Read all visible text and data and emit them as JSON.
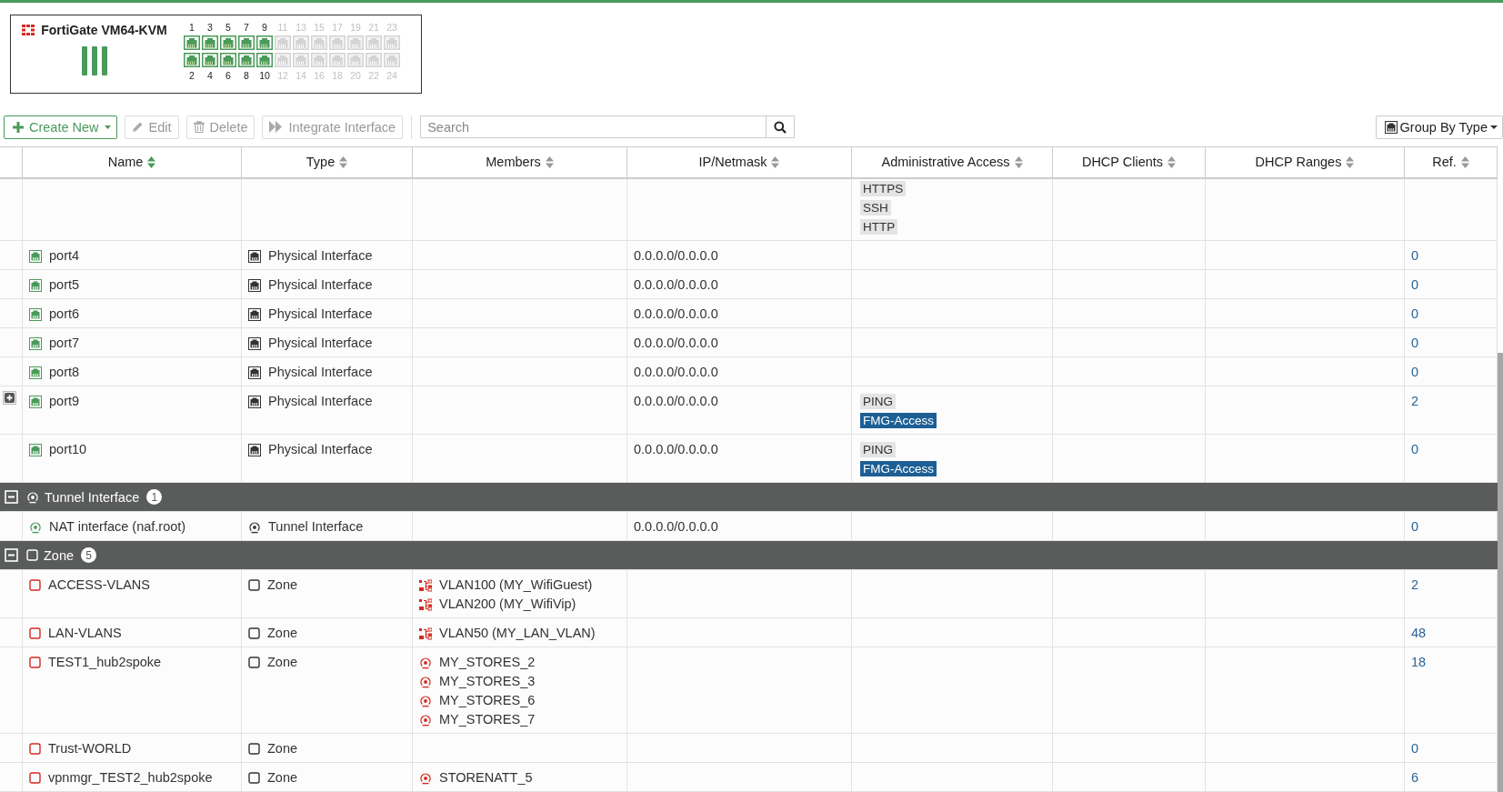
{
  "device": {
    "name": "FortiGate VM64-KVM",
    "ports_top": [
      {
        "label": "1",
        "active": true
      },
      {
        "label": "3",
        "active": true
      },
      {
        "label": "5",
        "active": true
      },
      {
        "label": "7",
        "active": true
      },
      {
        "label": "9",
        "active": true
      },
      {
        "label": "11",
        "active": false
      },
      {
        "label": "13",
        "active": false
      },
      {
        "label": "15",
        "active": false
      },
      {
        "label": "17",
        "active": false
      },
      {
        "label": "19",
        "active": false
      },
      {
        "label": "21",
        "active": false
      },
      {
        "label": "23",
        "active": false
      }
    ],
    "ports_bottom": [
      {
        "label": "2",
        "active": true
      },
      {
        "label": "4",
        "active": true
      },
      {
        "label": "6",
        "active": true
      },
      {
        "label": "8",
        "active": true
      },
      {
        "label": "10",
        "active": true
      },
      {
        "label": "12",
        "active": false
      },
      {
        "label": "14",
        "active": false
      },
      {
        "label": "16",
        "active": false
      },
      {
        "label": "18",
        "active": false
      },
      {
        "label": "20",
        "active": false
      },
      {
        "label": "22",
        "active": false
      },
      {
        "label": "24",
        "active": false
      }
    ]
  },
  "toolbar": {
    "buttons": [
      {
        "kind": "create",
        "label": "Create New",
        "disabled": false
      },
      {
        "kind": "edit",
        "label": "Edit",
        "disabled": true
      },
      {
        "kind": "delete",
        "label": "Delete",
        "disabled": true
      },
      {
        "kind": "integrate",
        "label": "Integrate Interface",
        "disabled": true
      }
    ],
    "search": {
      "placeholder": "Search"
    },
    "group_by": {
      "label": "Group By Type"
    }
  },
  "table": {
    "columns": [
      {
        "label": "Name",
        "sorted": true
      },
      {
        "label": "Type",
        "sorted": false
      },
      {
        "label": "Members",
        "sorted": false
      },
      {
        "label": "IP/Netmask",
        "sorted": false
      },
      {
        "label": "Administrative Access",
        "sorted": false
      },
      {
        "label": "DHCP Clients",
        "sorted": false
      },
      {
        "label": "DHCP Ranges",
        "sorted": false
      },
      {
        "label": "Ref.",
        "sorted": false
      }
    ],
    "rows": [
      {
        "kind": "partial",
        "access": [
          {
            "label": "HTTPS",
            "highlighted": false
          },
          {
            "label": "SSH",
            "highlighted": false
          },
          {
            "label": "HTTP",
            "highlighted": false
          }
        ]
      },
      {
        "kind": "port",
        "name": "port4",
        "type": "Physical Interface",
        "ip": "0.0.0.0/0.0.0.0",
        "ref": "0",
        "expandable": false
      },
      {
        "kind": "port",
        "name": "port5",
        "type": "Physical Interface",
        "ip": "0.0.0.0/0.0.0.0",
        "ref": "0",
        "expandable": false
      },
      {
        "kind": "port",
        "name": "port6",
        "type": "Physical Interface",
        "ip": "0.0.0.0/0.0.0.0",
        "ref": "0",
        "expandable": false
      },
      {
        "kind": "port",
        "name": "port7",
        "type": "Physical Interface",
        "ip": "0.0.0.0/0.0.0.0",
        "ref": "0",
        "expandable": false
      },
      {
        "kind": "port",
        "name": "port8",
        "type": "Physical Interface",
        "ip": "0.0.0.0/0.0.0.0",
        "ref": "0",
        "expandable": false
      },
      {
        "kind": "port",
        "name": "port9",
        "type": "Physical Interface",
        "ip": "0.0.0.0/0.0.0.0",
        "access": [
          {
            "label": "PING",
            "highlighted": false
          },
          {
            "label": "FMG-Access",
            "highlighted": true
          }
        ],
        "ref": "2",
        "expandable": true
      },
      {
        "kind": "port",
        "name": "port10",
        "type": "Physical Interface",
        "ip": "0.0.0.0/0.0.0.0",
        "access": [
          {
            "label": "PING",
            "highlighted": false
          },
          {
            "label": "FMG-Access",
            "highlighted": true
          }
        ],
        "ref": "0",
        "expandable": false
      },
      {
        "kind": "tunnel_group",
        "label": "Tunnel Interface",
        "count": "1",
        "expanded": true
      },
      {
        "kind": "tunnel",
        "name": "NAT interface (naf.root)",
        "type": "Tunnel Interface",
        "ip": "0.0.0.0/0.0.0.0",
        "ref": "0",
        "expandable": false
      },
      {
        "kind": "zone_group",
        "label": "Zone",
        "count": "5",
        "expanded": true
      },
      {
        "kind": "zone",
        "name": "ACCESS-VLANS",
        "type": "Zone",
        "members": [
          {
            "kind": "vlan",
            "label": "VLAN100 (MY_WifiGuest)"
          },
          {
            "kind": "vlan",
            "label": "VLAN200 (MY_WifiVip)"
          }
        ],
        "ref": "2",
        "expandable": false
      },
      {
        "kind": "zone",
        "name": "LAN-VLANS",
        "type": "Zone",
        "members": [
          {
            "kind": "vlan",
            "label": "VLAN50 (MY_LAN_VLAN)"
          }
        ],
        "ref": "48",
        "expandable": false
      },
      {
        "kind": "zone",
        "name": "TEST1_hub2spoke",
        "type": "Zone",
        "members": [
          {
            "kind": "tunnel",
            "label": "MY_STORES_2"
          },
          {
            "kind": "tunnel",
            "label": "MY_STORES_3"
          },
          {
            "kind": "tunnel",
            "label": "MY_STORES_6"
          },
          {
            "kind": "tunnel",
            "label": "MY_STORES_7"
          }
        ],
        "ref": "18",
        "expandable": false
      },
      {
        "kind": "zone",
        "name": "Trust-WORLD",
        "type": "Zone",
        "ref": "0",
        "expandable": false
      },
      {
        "kind": "zone",
        "name": "vpnmgr_TEST2_hub2spoke",
        "type": "Zone",
        "members": [
          {
            "kind": "tunnel",
            "label": "STORENATT_5"
          }
        ],
        "ref": "6",
        "expandable": false
      }
    ]
  }
}
